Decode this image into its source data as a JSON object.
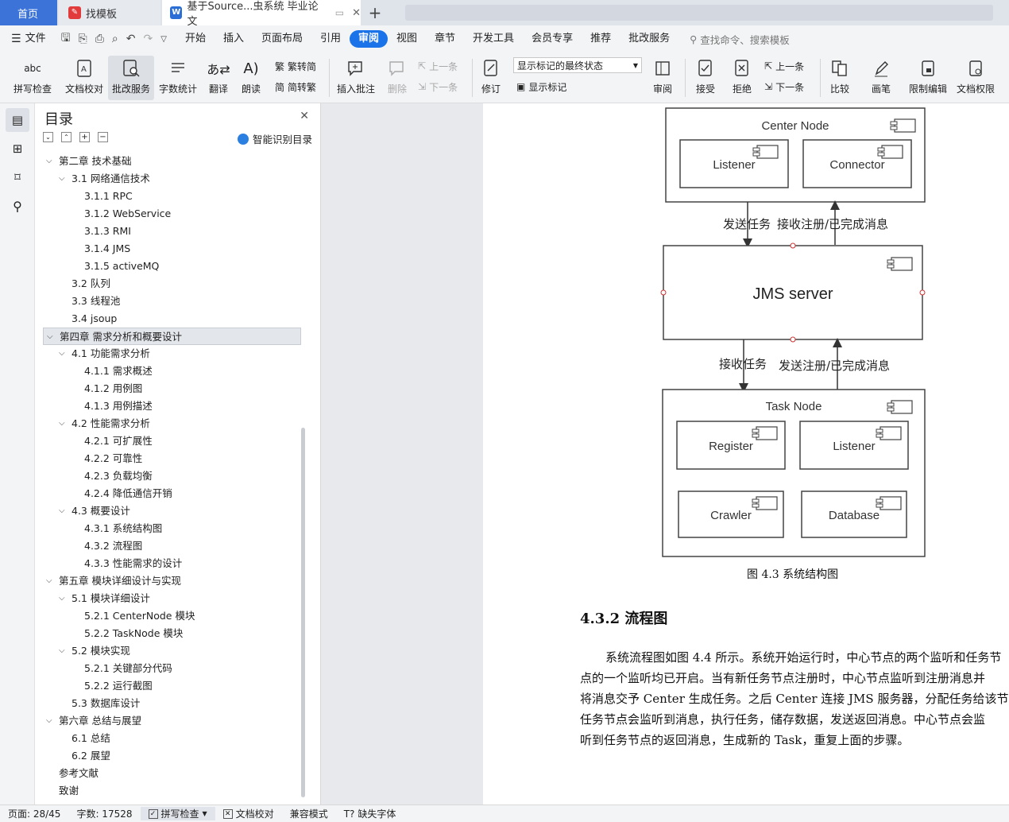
{
  "tabs": [
    {
      "label": "首页",
      "active": false
    },
    {
      "label": "找模板",
      "active": false
    },
    {
      "label": "基于Source...虫系统 毕业论文",
      "active": true
    }
  ],
  "menubar": {
    "file_label": "文件",
    "items": [
      "开始",
      "插入",
      "页面布局",
      "引用",
      "审阅",
      "视图",
      "章节",
      "开发工具",
      "会员专享",
      "推荐",
      "批改服务"
    ],
    "active": "审阅",
    "search_placeholder": "查找命令、搜索模板"
  },
  "ribbon": {
    "spell": "拼写检查",
    "proof": "文档校对",
    "correct": "批改服务",
    "wordcount": "字数统计",
    "translate": "翻译",
    "read": "朗读",
    "trad": "繁转简",
    "simp": "简转繁",
    "insert_comment": "插入批注",
    "delete": "删除",
    "prev_comment": "上一条",
    "next_comment": "下一条",
    "revise": "修订",
    "markup_state": "显示标记的最终状态",
    "show_markup": "显示标记",
    "review": "审阅",
    "accept": "接受",
    "reject": "拒绝",
    "prev": "上一条",
    "next": "下一条",
    "compare": "比较",
    "pen": "画笔",
    "restrict": "限制编辑",
    "perm": "文档权限"
  },
  "toc": {
    "title": "目录",
    "smart": "智能识别目录",
    "items": [
      {
        "text": "第二章  技术基础",
        "level": 0,
        "caret": true
      },
      {
        "text": "3.1  网络通信技术",
        "level": 1,
        "caret": true
      },
      {
        "text": "3.1.1 RPC",
        "level": 2,
        "caret": false
      },
      {
        "text": "3.1.2 WebService",
        "level": 2,
        "caret": false
      },
      {
        "text": "3.1.3 RMI",
        "level": 2,
        "caret": false
      },
      {
        "text": "3.1.4 JMS",
        "level": 2,
        "caret": false
      },
      {
        "text": "3.1.5 activeMQ",
        "level": 2,
        "caret": false
      },
      {
        "text": "3.2  队列",
        "level": 1,
        "caret": false
      },
      {
        "text": "3.3  线程池",
        "level": 1,
        "caret": false
      },
      {
        "text": "3.4 jsoup",
        "level": 1,
        "caret": false
      },
      {
        "text": "第四章  需求分析和概要设计",
        "level": 0,
        "caret": true,
        "selected": true
      },
      {
        "text": "4.1  功能需求分析",
        "level": 1,
        "caret": true
      },
      {
        "text": "4.1.1  需求概述",
        "level": 2,
        "caret": false
      },
      {
        "text": "4.1.2  用例图",
        "level": 2,
        "caret": false
      },
      {
        "text": "4.1.3  用例描述",
        "level": 2,
        "caret": false
      },
      {
        "text": "4.2  性能需求分析",
        "level": 1,
        "caret": true
      },
      {
        "text": "4.2.1  可扩展性",
        "level": 2,
        "caret": false
      },
      {
        "text": "4.2.2  可靠性",
        "level": 2,
        "caret": false
      },
      {
        "text": "4.2.3  负载均衡",
        "level": 2,
        "caret": false
      },
      {
        "text": "4.2.4  降低通信开销",
        "level": 2,
        "caret": false
      },
      {
        "text": "4.3  概要设计",
        "level": 1,
        "caret": true
      },
      {
        "text": "4.3.1  系统结构图",
        "level": 2,
        "caret": false
      },
      {
        "text": "4.3.2  流程图",
        "level": 2,
        "caret": false
      },
      {
        "text": "4.3.3  性能需求的设计",
        "level": 2,
        "caret": false
      },
      {
        "text": "第五章  模块详细设计与实现",
        "level": 0,
        "caret": true
      },
      {
        "text": "5.1  模块详细设计",
        "level": 1,
        "caret": true
      },
      {
        "text": "5.2.1 CenterNode 模块",
        "level": 2,
        "caret": false
      },
      {
        "text": "5.2.2 TaskNode 模块",
        "level": 2,
        "caret": false
      },
      {
        "text": "5.2  模块实现",
        "level": 1,
        "caret": true
      },
      {
        "text": "5.2.1  关键部分代码",
        "level": 2,
        "caret": false
      },
      {
        "text": "5.2.2  运行截图",
        "level": 2,
        "caret": false
      },
      {
        "text": "5.3  数据库设计",
        "level": 1,
        "caret": false
      },
      {
        "text": "第六章  总结与展望",
        "level": 0,
        "caret": true
      },
      {
        "text": "6.1  总结",
        "level": 1,
        "caret": false
      },
      {
        "text": "6.2  展望",
        "level": 1,
        "caret": false
      },
      {
        "text": "参考文献",
        "level": 0,
        "caret": false
      },
      {
        "text": "致谢",
        "level": 0,
        "caret": false
      }
    ]
  },
  "diagram": {
    "center_node": "Center Node",
    "listener": "Listener",
    "connector": "Connector",
    "send_task": "发送任务",
    "recv_register": "接收注册/已完成消息",
    "jms_server": "JMS server",
    "recv_task": "接收任务",
    "send_register": "发送注册/已完成消息",
    "task_node": "Task Node",
    "register": "Register",
    "listener2": "Listener",
    "crawler": "Crawler",
    "database": "Database"
  },
  "doc": {
    "caption": "图 4.3  系统结构图",
    "heading": "4.3.2  流程图",
    "lines": [
      "系统流程图如图 4.4 所示。系统开始运行时，中心节点的两个监听和任务节",
      "点的一个监听均已开启。当有新任务节点注册时，中心节点监听到注册消息并",
      "将消息交予 Center 生成任务。之后 Center 连接 JMS 服务器，分配任务给该节点，",
      "任务节点会监听到消息，执行任务，储存数据，发送返回消息。中心节点会监",
      "听到任务节点的返回消息，生成新的 Task，重复上面的步骤。"
    ]
  },
  "status": {
    "page": "页面: 28/45",
    "words": "字数: 17528",
    "spell": "拼写检查",
    "proof": "文档校对",
    "compat": "兼容模式",
    "missing_font": "缺失字体"
  }
}
